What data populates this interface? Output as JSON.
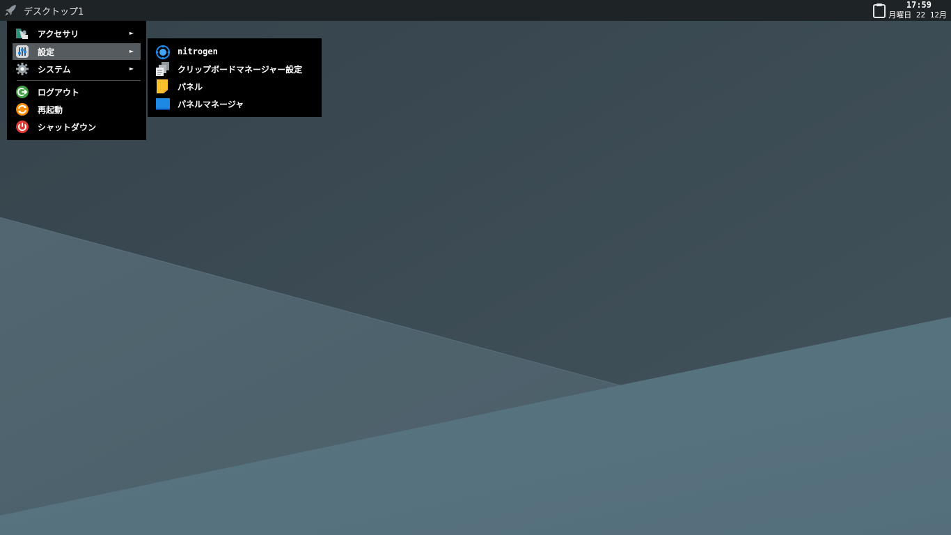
{
  "panel": {
    "desktop_name": "デスクトップ1",
    "clock_time": "17:59",
    "clock_date": "月曜日 22 12月"
  },
  "menu": {
    "items": [
      {
        "label": "アクセサリ",
        "arrow": "►",
        "icon": "accessories-icon"
      },
      {
        "label": "設定",
        "arrow": "►",
        "icon": "settings-icon"
      },
      {
        "label": "システム",
        "arrow": "►",
        "icon": "system-gear-icon"
      },
      {
        "label": "ログアウト",
        "icon": "logout-icon"
      },
      {
        "label": "再起動",
        "icon": "restart-icon"
      },
      {
        "label": "シャットダウン",
        "icon": "shutdown-icon"
      }
    ],
    "active_item": "設定"
  },
  "submenu": {
    "items": [
      {
        "label": "nitrogen",
        "icon": "nitrogen-icon"
      },
      {
        "label": "クリップボードマネージャー設定",
        "icon": "clipboard-manager-icon"
      },
      {
        "label": "パネル",
        "icon": "panel-note-icon"
      },
      {
        "label": "パネルマネージャ",
        "icon": "panel-manager-icon"
      }
    ]
  },
  "colors": {
    "panel_bg": "#1e2326",
    "menu_bg": "#000000",
    "menu_active": "#555b5e",
    "wallpaper_dark": "#3e4e57",
    "wallpaper_light": "#557380"
  }
}
